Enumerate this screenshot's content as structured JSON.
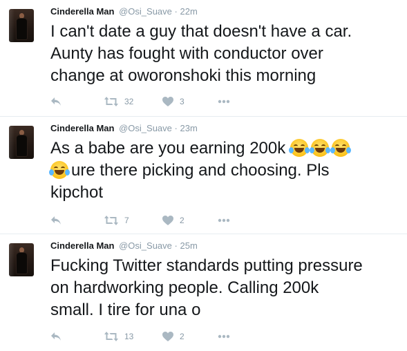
{
  "tweets": [
    {
      "name": "Cinderella Man",
      "handle": "@Osi_Suave",
      "separator": "·",
      "time": "22m",
      "text": "I can't date a guy that doesn't have a car.\nAunty has fought with conductor over\nchange at oworonshoki this morning",
      "retweets": "32",
      "likes": "3"
    },
    {
      "name": "Cinderella Man",
      "handle": "@Osi_Suave",
      "separator": "·",
      "time": "23m",
      "text_before": "As a babe are you earning 200k ",
      "emoji": "face-with-tears-of-joy",
      "text_after": "ure there picking and choosing. Pls\nkipchot",
      "retweets": "7",
      "likes": "2"
    },
    {
      "name": "Cinderella Man",
      "handle": "@Osi_Suave",
      "separator": "·",
      "time": "25m",
      "text": "Fucking Twitter standards putting pressure\non hardworking people. Calling 200k\nsmall. I tire for una o",
      "retweets": "13",
      "likes": "2"
    }
  ],
  "icons": {
    "reply": "reply-icon",
    "retweet": "retweet-icon",
    "like": "heart-icon",
    "more": "more-icon"
  },
  "colors": {
    "text": "#14171a",
    "muted": "#8899a6",
    "icon": "#aab8c2",
    "divider": "#e6ecf0"
  }
}
